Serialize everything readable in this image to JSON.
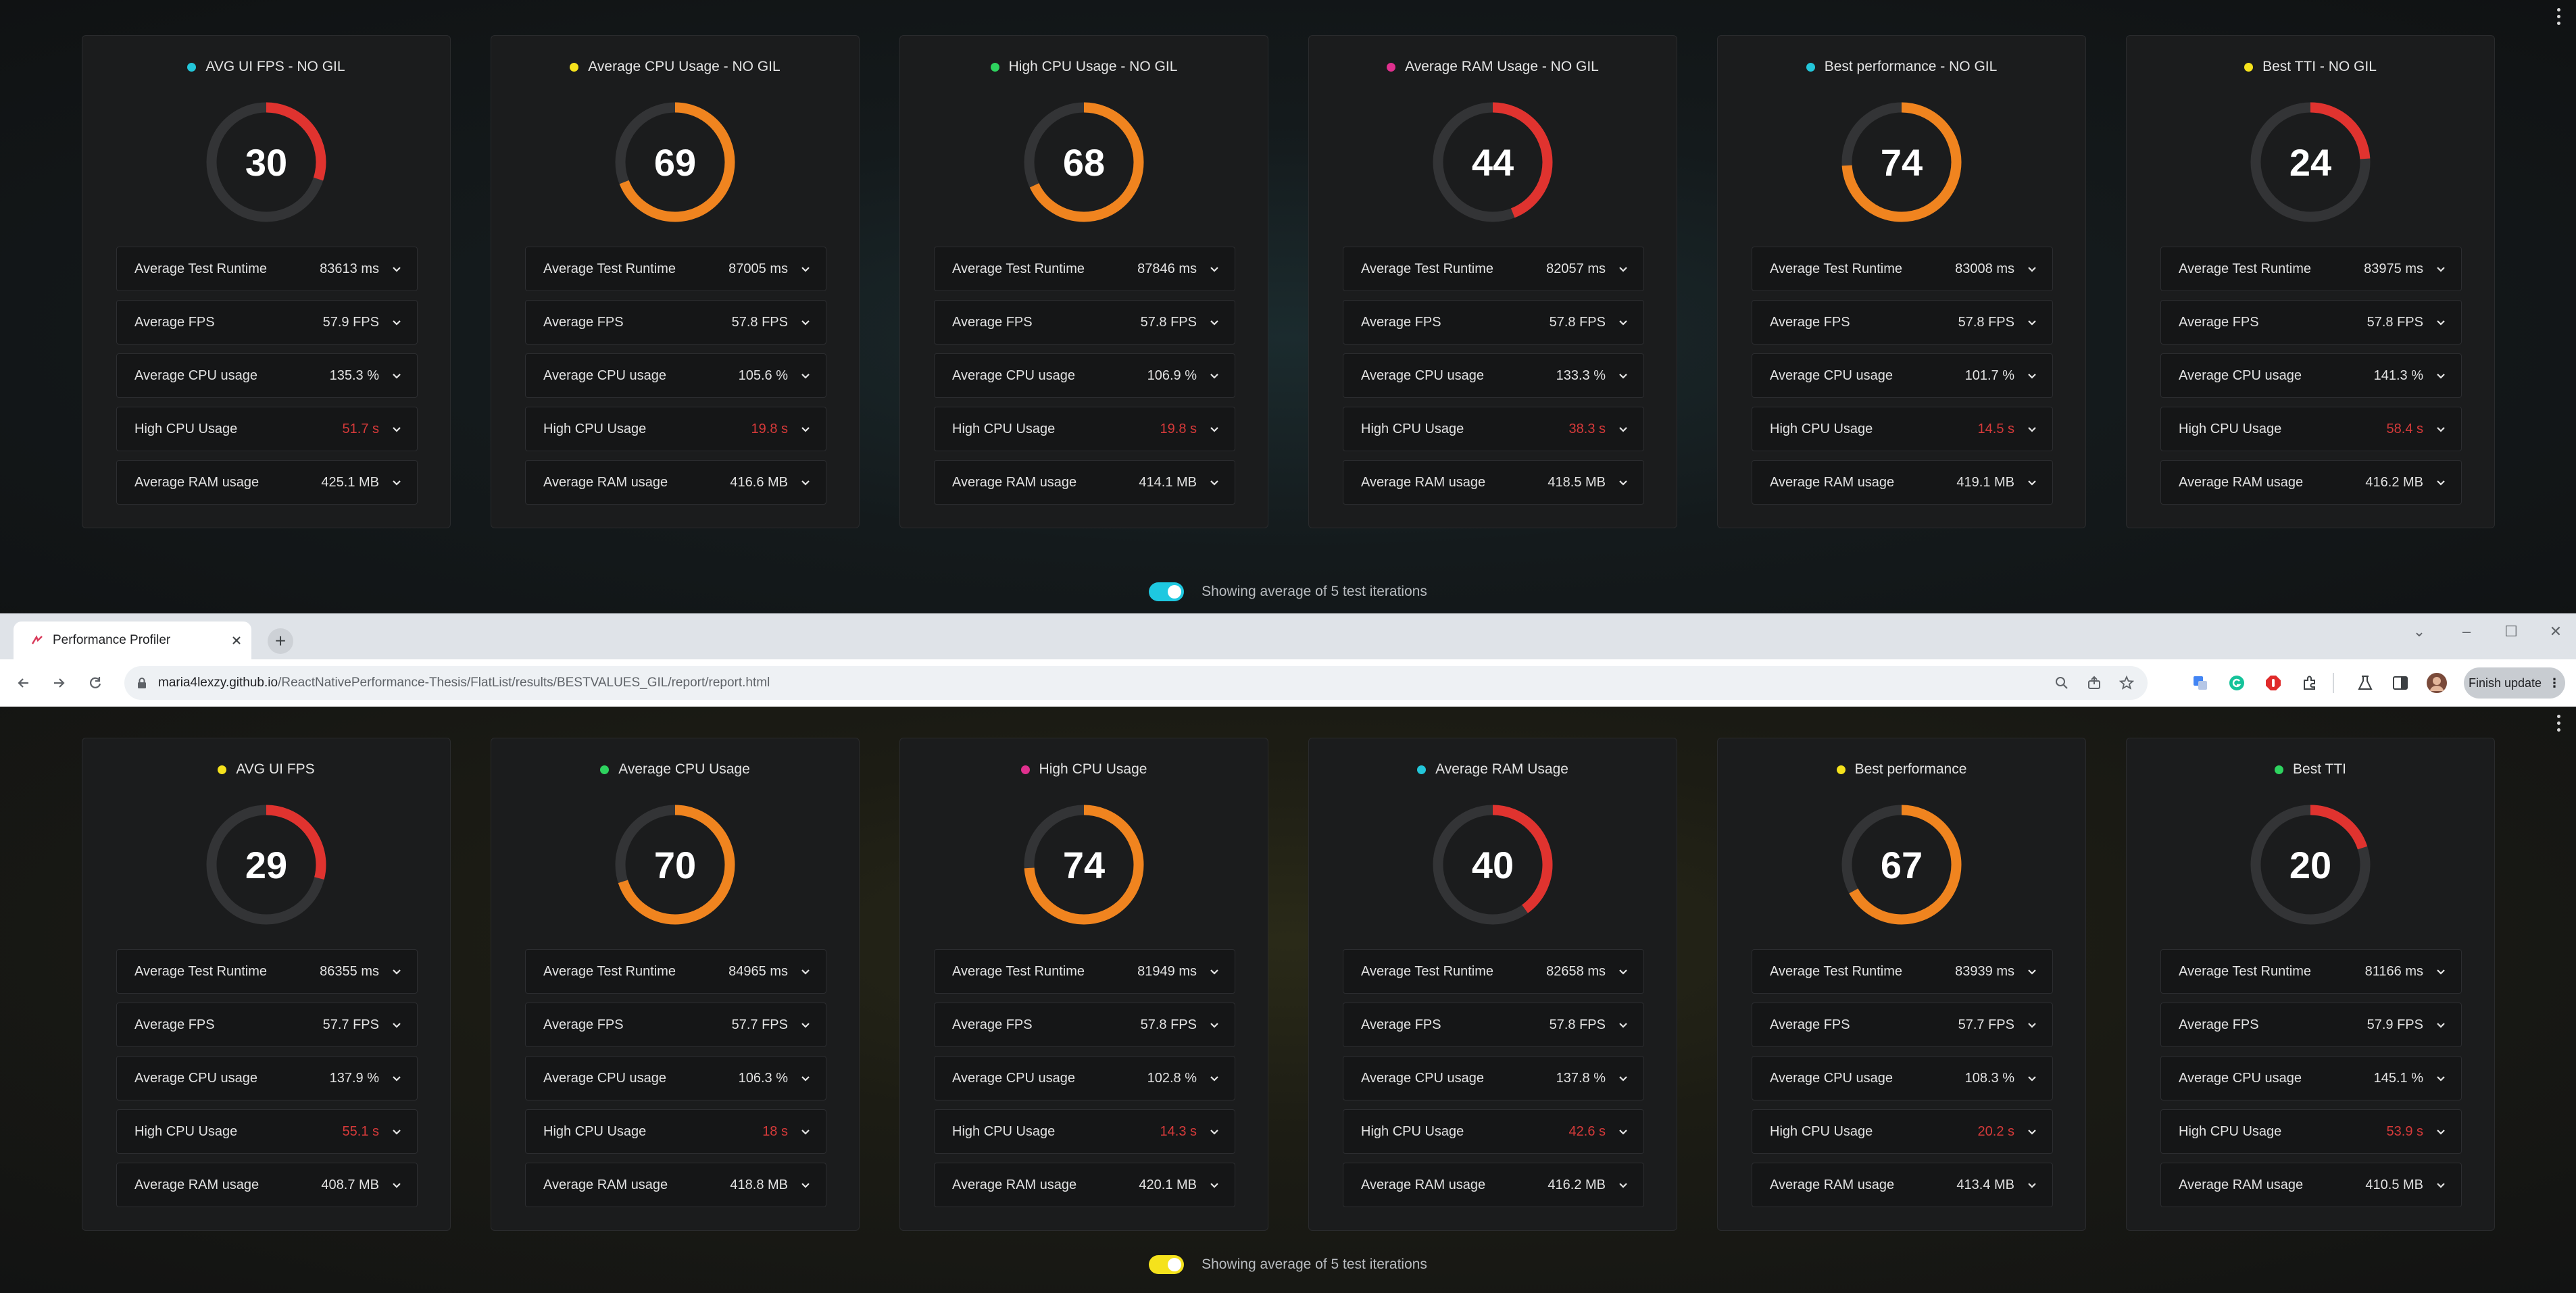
{
  "top_report": {
    "cards": [
      {
        "title": "AVG UI FPS - NO GIL",
        "dot": "#23c6d9",
        "score": "30",
        "fraction": 0.3,
        "arc": "#e0332f",
        "metrics": [
          {
            "label": "Average Test Runtime",
            "value": "83613 ms"
          },
          {
            "label": "Average FPS",
            "value": "57.9 FPS"
          },
          {
            "label": "Average CPU usage",
            "value": "135.3 %"
          },
          {
            "label": "High CPU Usage",
            "value": "51.7 s",
            "warn": true
          },
          {
            "label": "Average RAM usage",
            "value": "425.1 MB"
          }
        ]
      },
      {
        "title": "Average CPU Usage - NO GIL",
        "dot": "#f5e21c",
        "score": "69",
        "fraction": 0.69,
        "arc": "#f0841f",
        "metrics": [
          {
            "label": "Average Test Runtime",
            "value": "87005 ms"
          },
          {
            "label": "Average FPS",
            "value": "57.8 FPS"
          },
          {
            "label": "Average CPU usage",
            "value": "105.6 %"
          },
          {
            "label": "High CPU Usage",
            "value": "19.8 s",
            "warn": true
          },
          {
            "label": "Average RAM usage",
            "value": "416.6 MB"
          }
        ]
      },
      {
        "title": "High CPU Usage - NO GIL",
        "dot": "#2ed35f",
        "score": "68",
        "fraction": 0.68,
        "arc": "#f0841f",
        "metrics": [
          {
            "label": "Average Test Runtime",
            "value": "87846 ms"
          },
          {
            "label": "Average FPS",
            "value": "57.8 FPS"
          },
          {
            "label": "Average CPU usage",
            "value": "106.9 %"
          },
          {
            "label": "High CPU Usage",
            "value": "19.8 s",
            "warn": true
          },
          {
            "label": "Average RAM usage",
            "value": "414.1 MB"
          }
        ]
      },
      {
        "title": "Average RAM Usage - NO GIL",
        "dot": "#e0308e",
        "score": "44",
        "fraction": 0.44,
        "arc": "#e0332f",
        "metrics": [
          {
            "label": "Average Test Runtime",
            "value": "82057 ms"
          },
          {
            "label": "Average FPS",
            "value": "57.8 FPS"
          },
          {
            "label": "Average CPU usage",
            "value": "133.3 %"
          },
          {
            "label": "High CPU Usage",
            "value": "38.3 s",
            "warn": true
          },
          {
            "label": "Average RAM usage",
            "value": "418.5 MB"
          }
        ]
      },
      {
        "title": "Best performance - NO GIL",
        "dot": "#23c6d9",
        "score": "74",
        "fraction": 0.74,
        "arc": "#f0841f",
        "metrics": [
          {
            "label": "Average Test Runtime",
            "value": "83008 ms"
          },
          {
            "label": "Average FPS",
            "value": "57.8 FPS"
          },
          {
            "label": "Average CPU usage",
            "value": "101.7 %"
          },
          {
            "label": "High CPU Usage",
            "value": "14.5 s",
            "warn": true
          },
          {
            "label": "Average RAM usage",
            "value": "419.1 MB"
          }
        ]
      },
      {
        "title": "Best TTI - NO GIL",
        "dot": "#f5e21c",
        "score": "24",
        "fraction": 0.24,
        "arc": "#e0332f",
        "metrics": [
          {
            "label": "Average Test Runtime",
            "value": "83975 ms"
          },
          {
            "label": "Average FPS",
            "value": "57.8 FPS"
          },
          {
            "label": "Average CPU usage",
            "value": "141.3 %"
          },
          {
            "label": "High CPU Usage",
            "value": "58.4 s",
            "warn": true
          },
          {
            "label": "Average RAM usage",
            "value": "416.2 MB"
          }
        ]
      }
    ],
    "toggle_text": "Showing average of 5 test iterations",
    "toggle_color": "#1ec8e0"
  },
  "browser": {
    "tab_title": "Performance Profiler",
    "url_host": "maria4lexzy.github.io",
    "url_path": "/ReactNativePerformance-Thesis/FlatList/results/BESTVALUES_GIL/report/report.html",
    "finish_update": "Finish update"
  },
  "bottom_report": {
    "cards": [
      {
        "title": "AVG UI FPS",
        "dot": "#f5e21c",
        "score": "29",
        "fraction": 0.29,
        "arc": "#e0332f",
        "metrics": [
          {
            "label": "Average Test Runtime",
            "value": "86355 ms"
          },
          {
            "label": "Average FPS",
            "value": "57.7 FPS"
          },
          {
            "label": "Average CPU usage",
            "value": "137.9 %"
          },
          {
            "label": "High CPU Usage",
            "value": "55.1 s",
            "warn": true
          },
          {
            "label": "Average RAM usage",
            "value": "408.7 MB"
          }
        ]
      },
      {
        "title": "Average CPU Usage",
        "dot": "#2ed35f",
        "score": "70",
        "fraction": 0.7,
        "arc": "#f0841f",
        "metrics": [
          {
            "label": "Average Test Runtime",
            "value": "84965 ms"
          },
          {
            "label": "Average FPS",
            "value": "57.7 FPS"
          },
          {
            "label": "Average CPU usage",
            "value": "106.3 %"
          },
          {
            "label": "High CPU Usage",
            "value": "18 s",
            "warn": true
          },
          {
            "label": "Average RAM usage",
            "value": "418.8 MB"
          }
        ]
      },
      {
        "title": "High CPU Usage",
        "dot": "#e0308e",
        "score": "74",
        "fraction": 0.74,
        "arc": "#f0841f",
        "metrics": [
          {
            "label": "Average Test Runtime",
            "value": "81949 ms"
          },
          {
            "label": "Average FPS",
            "value": "57.8 FPS"
          },
          {
            "label": "Average CPU usage",
            "value": "102.8 %"
          },
          {
            "label": "High CPU Usage",
            "value": "14.3 s",
            "warn": true
          },
          {
            "label": "Average RAM usage",
            "value": "420.1 MB"
          }
        ]
      },
      {
        "title": "Average RAM Usage",
        "dot": "#23c6d9",
        "score": "40",
        "fraction": 0.4,
        "arc": "#e0332f",
        "metrics": [
          {
            "label": "Average Test Runtime",
            "value": "82658 ms"
          },
          {
            "label": "Average FPS",
            "value": "57.8 FPS"
          },
          {
            "label": "Average CPU usage",
            "value": "137.8 %"
          },
          {
            "label": "High CPU Usage",
            "value": "42.6 s",
            "warn": true
          },
          {
            "label": "Average RAM usage",
            "value": "416.2 MB"
          }
        ]
      },
      {
        "title": "Best performance",
        "dot": "#f5e21c",
        "score": "67",
        "fraction": 0.67,
        "arc": "#f0841f",
        "metrics": [
          {
            "label": "Average Test Runtime",
            "value": "83939 ms"
          },
          {
            "label": "Average FPS",
            "value": "57.7 FPS"
          },
          {
            "label": "Average CPU usage",
            "value": "108.3 %"
          },
          {
            "label": "High CPU Usage",
            "value": "20.2 s",
            "warn": true
          },
          {
            "label": "Average RAM usage",
            "value": "413.4 MB"
          }
        ]
      },
      {
        "title": "Best TTI",
        "dot": "#2ed35f",
        "score": "20",
        "fraction": 0.2,
        "arc": "#e0332f",
        "metrics": [
          {
            "label": "Average Test Runtime",
            "value": "81166 ms"
          },
          {
            "label": "Average FPS",
            "value": "57.9 FPS"
          },
          {
            "label": "Average CPU usage",
            "value": "145.1 %"
          },
          {
            "label": "High CPU Usage",
            "value": "53.9 s",
            "warn": true
          },
          {
            "label": "Average RAM usage",
            "value": "410.5 MB"
          }
        ]
      }
    ],
    "toggle_text": "Showing average of 5 test iterations",
    "toggle_color": "#f5e21c"
  },
  "colors": {
    "gauge_track": "#333436",
    "warn_text": "#d63a3a"
  },
  "icons": [
    "chevron-down-icon",
    "kebab-menu-icon",
    "lock-icon",
    "back-icon",
    "forward-icon",
    "reload-icon",
    "zoom-icon",
    "share-icon",
    "star-icon",
    "translate-icon",
    "grammarly-icon",
    "adblock-icon",
    "extensions-icon",
    "labs-icon",
    "sidepanel-icon",
    "avatar"
  ]
}
